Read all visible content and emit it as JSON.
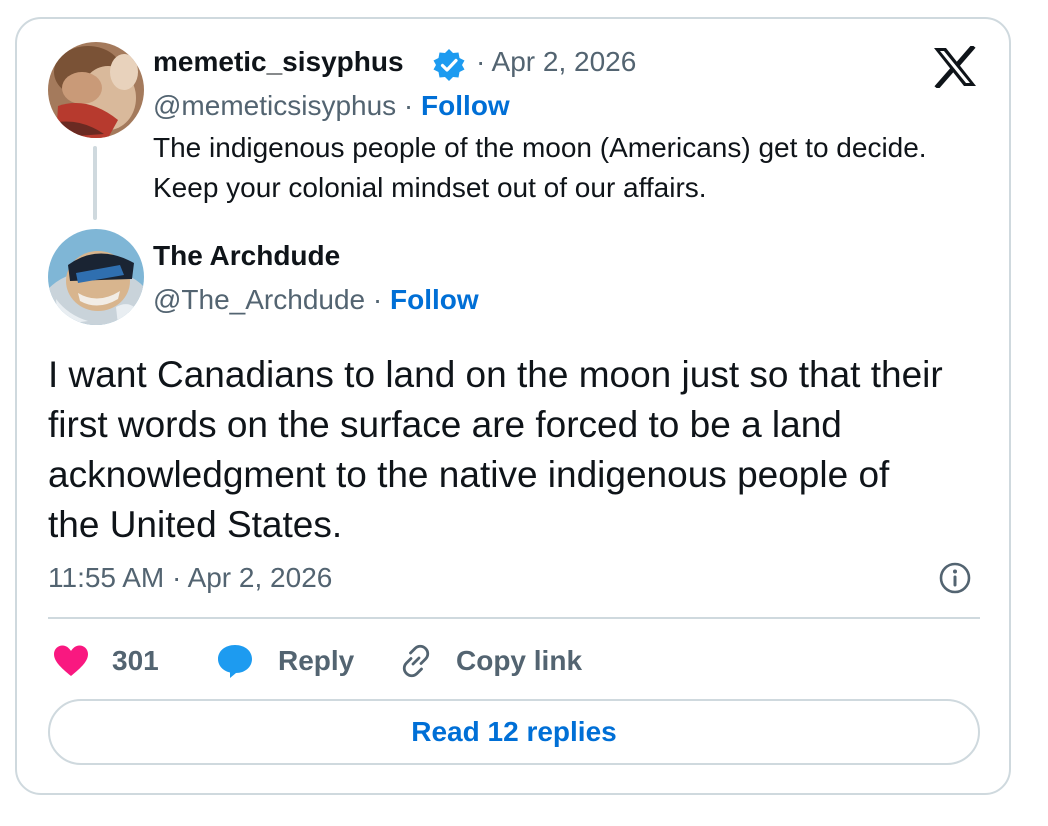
{
  "quoted_tweet": {
    "author_name": "memetic_sisyphus",
    "date": "· Apr 2, 2026",
    "handle": "@memeticsisyphus",
    "separator": " · ",
    "follow_label": "Follow",
    "text": "The indigenous people of the moon (Americans) get to decide. Keep your colonial mindset out of our affairs."
  },
  "main_tweet": {
    "author_name": "The Archdude",
    "handle": "@The_Archdude",
    "separator": " · ",
    "follow_label": "Follow",
    "text": "I want Canadians to land on the moon just so that their first words on the surface are forced to be a land acknowledgment to the native indigenous people of the United States.",
    "timestamp": "11:55 AM · Apr 2, 2026"
  },
  "actions": {
    "like_count": "301",
    "reply_label": "Reply",
    "copy_link_label": "Copy link",
    "read_replies_label": "Read 12 replies"
  },
  "icons": {
    "brand": "x-logo-icon",
    "verified": "verified-badge-icon",
    "like": "heart-icon",
    "reply": "speech-bubble-icon",
    "copy_link": "link-icon",
    "info": "info-icon"
  },
  "colors": {
    "accent": "#006fd6",
    "verified": "#1d9bf0",
    "like": "#f91880",
    "secondary_text": "#536471",
    "border": "#cfd9de"
  }
}
